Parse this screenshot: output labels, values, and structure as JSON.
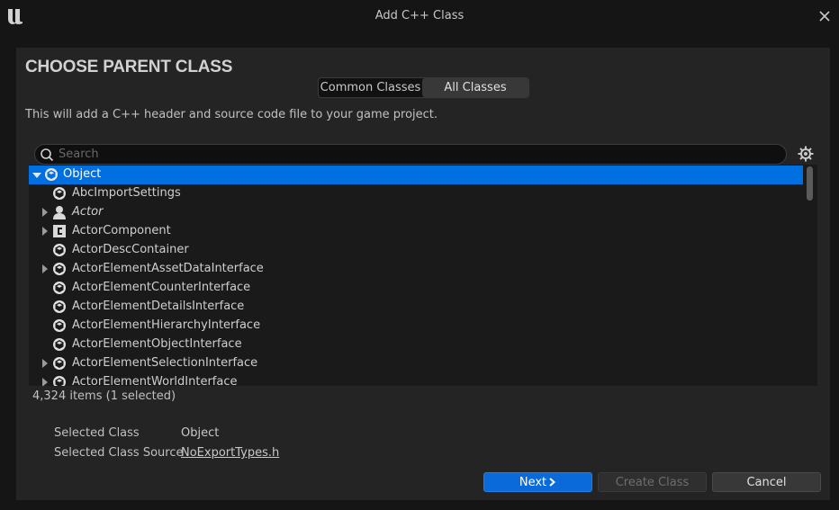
{
  "window": {
    "title": "Add C++ Class"
  },
  "heading": "CHOOSE PARENT CLASS",
  "tabs": [
    {
      "label": "Common Classes",
      "active": false
    },
    {
      "label": "All Classes",
      "active": true
    }
  ],
  "description": "This will add a C++ header and source code file to your game project.",
  "search": {
    "placeholder": "Search",
    "value": ""
  },
  "tree": {
    "items": [
      {
        "label": "Object",
        "icon": "object-class-icon",
        "expanded": true,
        "selected": true
      },
      {
        "label": "AbcImportSettings",
        "icon": "object-class-icon"
      },
      {
        "label": "Actor",
        "icon": "actor-class-icon",
        "italic": true,
        "expandable": true
      },
      {
        "label": "ActorComponent",
        "icon": "component-class-icon",
        "expandable": true
      },
      {
        "label": "ActorDescContainer",
        "icon": "object-class-icon"
      },
      {
        "label": "ActorElementAssetDataInterface",
        "icon": "object-class-icon",
        "expandable": true
      },
      {
        "label": "ActorElementCounterInterface",
        "icon": "object-class-icon"
      },
      {
        "label": "ActorElementDetailsInterface",
        "icon": "object-class-icon"
      },
      {
        "label": "ActorElementHierarchyInterface",
        "icon": "object-class-icon"
      },
      {
        "label": "ActorElementObjectInterface",
        "icon": "object-class-icon"
      },
      {
        "label": "ActorElementSelectionInterface",
        "icon": "object-class-icon",
        "expandable": true
      },
      {
        "label": "ActorElementWorldInterface",
        "icon": "object-class-icon",
        "expandable": true
      }
    ]
  },
  "item_count": "4,324 items (1 selected)",
  "selected_class": {
    "label": "Selected Class",
    "value": "Object"
  },
  "selected_source": {
    "label": "Selected Class Source",
    "value": "NoExportTypes.h"
  },
  "buttons": {
    "next": "Next",
    "create": "Create Class",
    "cancel": "Cancel"
  },
  "colors": {
    "accent": "#0070e0",
    "panel": "#242424",
    "background": "#151515"
  }
}
